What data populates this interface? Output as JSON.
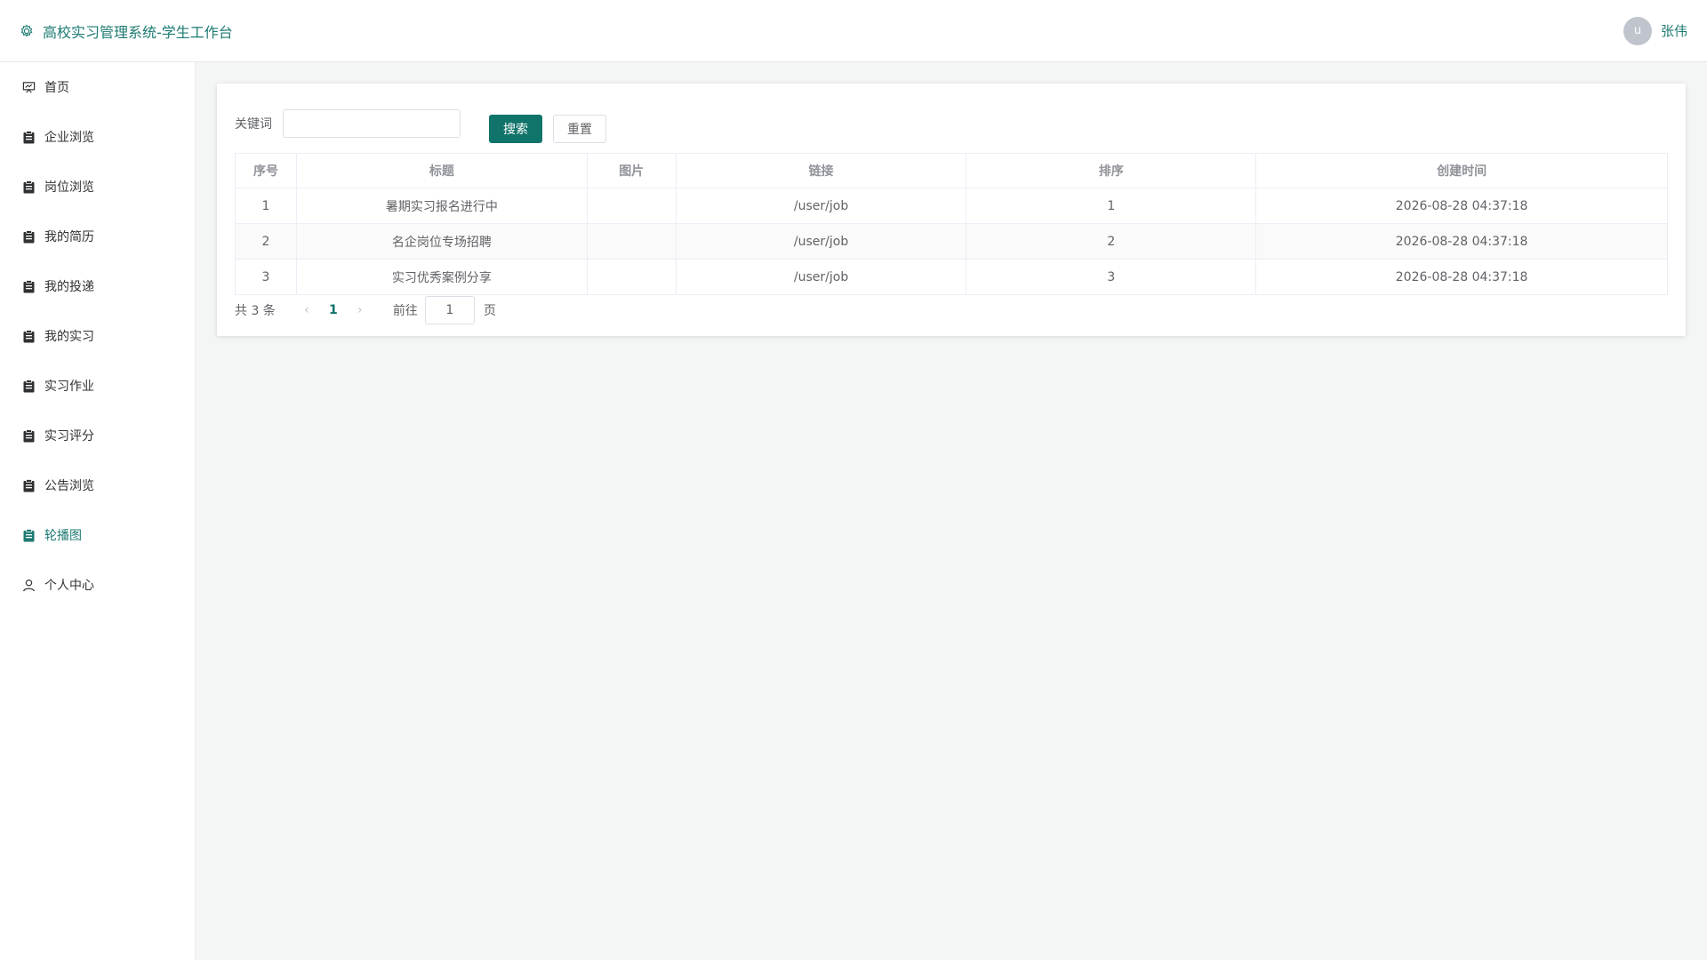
{
  "header": {
    "title": "高校实习管理系统-学生工作台",
    "avatar_letter": "u",
    "user_name": "张伟"
  },
  "sidebar": {
    "items": [
      {
        "label": "首页",
        "icon": "presentation-icon"
      },
      {
        "label": "企业浏览",
        "icon": "clipboard-icon"
      },
      {
        "label": "岗位浏览",
        "icon": "clipboard-icon"
      },
      {
        "label": "我的简历",
        "icon": "clipboard-icon"
      },
      {
        "label": "我的投递",
        "icon": "clipboard-icon"
      },
      {
        "label": "我的实习",
        "icon": "clipboard-icon"
      },
      {
        "label": "实习作业",
        "icon": "clipboard-icon"
      },
      {
        "label": "实习评分",
        "icon": "clipboard-icon"
      },
      {
        "label": "公告浏览",
        "icon": "clipboard-icon"
      },
      {
        "label": "轮播图",
        "icon": "clipboard-icon",
        "active": true
      },
      {
        "label": "个人中心",
        "icon": "user-icon"
      }
    ]
  },
  "search": {
    "label": "关键词",
    "value": "",
    "placeholder": "",
    "search_button": "搜索",
    "reset_button": "重置"
  },
  "table": {
    "columns": [
      "序号",
      "标题",
      "图片",
      "链接",
      "排序",
      "创建时间"
    ],
    "rows": [
      [
        "1",
        "暑期实习报名进行中",
        "",
        "/user/job",
        "1",
        "2026-08-28 04:37:18"
      ],
      [
        "2",
        "名企岗位专场招聘",
        "",
        "/user/job",
        "2",
        "2026-08-28 04:37:18"
      ],
      [
        "3",
        "实习优秀案例分享",
        "",
        "/user/job",
        "3",
        "2026-08-28 04:37:18"
      ]
    ]
  },
  "pagination": {
    "total_text": "共 3 条",
    "current_page": "1",
    "goto_label": "前往",
    "goto_value": "1",
    "page_suffix": "页"
  },
  "colors": {
    "accent": "#11746a",
    "brand_text": "#1d7a72"
  }
}
